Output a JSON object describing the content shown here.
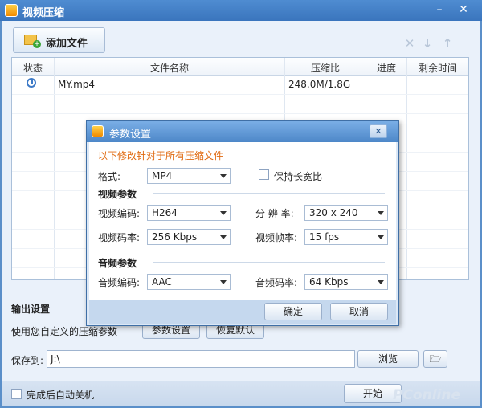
{
  "window": {
    "title": "视频压缩",
    "min": "–",
    "close": "✕"
  },
  "toolbar": {
    "add_file": "添加文件",
    "icons": [
      "close-icon",
      "arrow-down-icon",
      "arrow-up-icon"
    ]
  },
  "table": {
    "headers": [
      "状态",
      "文件名称",
      "压缩比",
      "进度",
      "剩余时间"
    ],
    "rows": [
      {
        "status_icon": "clock-icon",
        "name": "MY.mp4",
        "ratio": "248.0M/1.8G",
        "progress": "",
        "remaining": ""
      }
    ]
  },
  "output": {
    "title": "输出设置",
    "hint": "使用您自定义的压缩参数",
    "param_button": "参数设置",
    "restore_button": "恢复默认",
    "save_label": "保存到:",
    "save_path": "J:\\",
    "browse_button": "浏览"
  },
  "bottom": {
    "shutdown_label": "完成后自动关机",
    "shutdown_checked": false,
    "start_button": "开始",
    "watermark": "PConline 太平洋电脑网"
  },
  "dialog": {
    "title": "参数设置",
    "close": "✕",
    "notice": "以下修改针对于所有压缩文件",
    "format_label": "格式:",
    "format_value": "MP4",
    "keep_ratio_label": "保持长宽比",
    "keep_ratio_checked": false,
    "video_section": "视频参数",
    "video_codec_label": "视频编码:",
    "video_codec_value": "H264",
    "resolution_label": "分 辨 率:",
    "resolution_value": "320 x 240",
    "video_bitrate_label": "视频码率:",
    "video_bitrate_value": "256 Kbps",
    "framerate_label": "视频帧率:",
    "framerate_value": "15 fps",
    "audio_section": "音频参数",
    "audio_codec_label": "音频编码:",
    "audio_codec_value": "AAC",
    "audio_bitrate_label": "音频码率:",
    "audio_bitrate_value": "64 Kbps",
    "ok_button": "确定",
    "cancel_button": "取消"
  }
}
